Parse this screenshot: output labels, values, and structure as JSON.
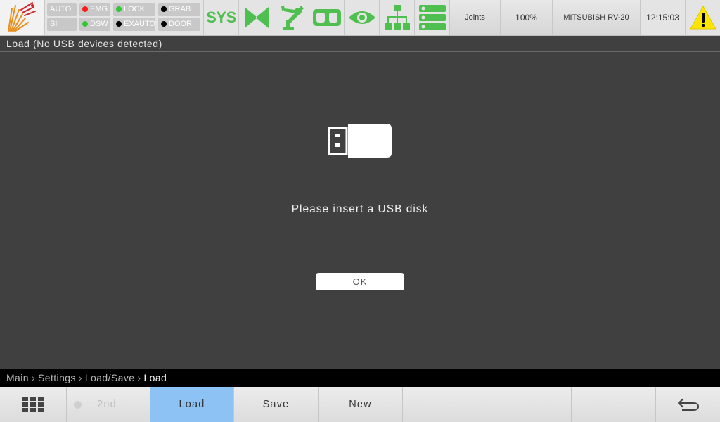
{
  "colors": {
    "accent_green": "#4fbf4f",
    "active_tab_blue": "#8cc3f4",
    "status_red": "#ff1a1a",
    "status_green": "#32c832",
    "status_black": "#000000",
    "warning_yellow": "#ffe600"
  },
  "status": {
    "mode_top": "AUTO",
    "mode_bottom": "SI",
    "emg": "EMG",
    "dsw": "DSW",
    "lock": "LOCK",
    "exauto": "EXAUTO",
    "grab": "GRAB",
    "door": "DOOR"
  },
  "toolbar": {
    "sys_label": "SYS",
    "icons": [
      "motion-icon",
      "robot-arm-icon",
      "io-icon",
      "eye-icon",
      "network-icon",
      "server-icon"
    ],
    "joints_label": "Joints",
    "speed_label": "100%",
    "robot_label": "MITSUBISH RV-20",
    "clock": "12:15:03",
    "warning_icon": "warning-icon"
  },
  "title": "Load  (No USB devices detected)",
  "dialog": {
    "message": "Please insert a USB disk",
    "ok_label": "OK"
  },
  "breadcrumb": {
    "items": [
      "Main",
      "Settings",
      "Load/Save"
    ],
    "current": "Load"
  },
  "bottom": {
    "menu_icon": "grid-menu-icon",
    "second_label": "2nd",
    "load_label": "Load",
    "save_label": "Save",
    "new_label": "New",
    "back_icon": "back-arrow-icon"
  }
}
